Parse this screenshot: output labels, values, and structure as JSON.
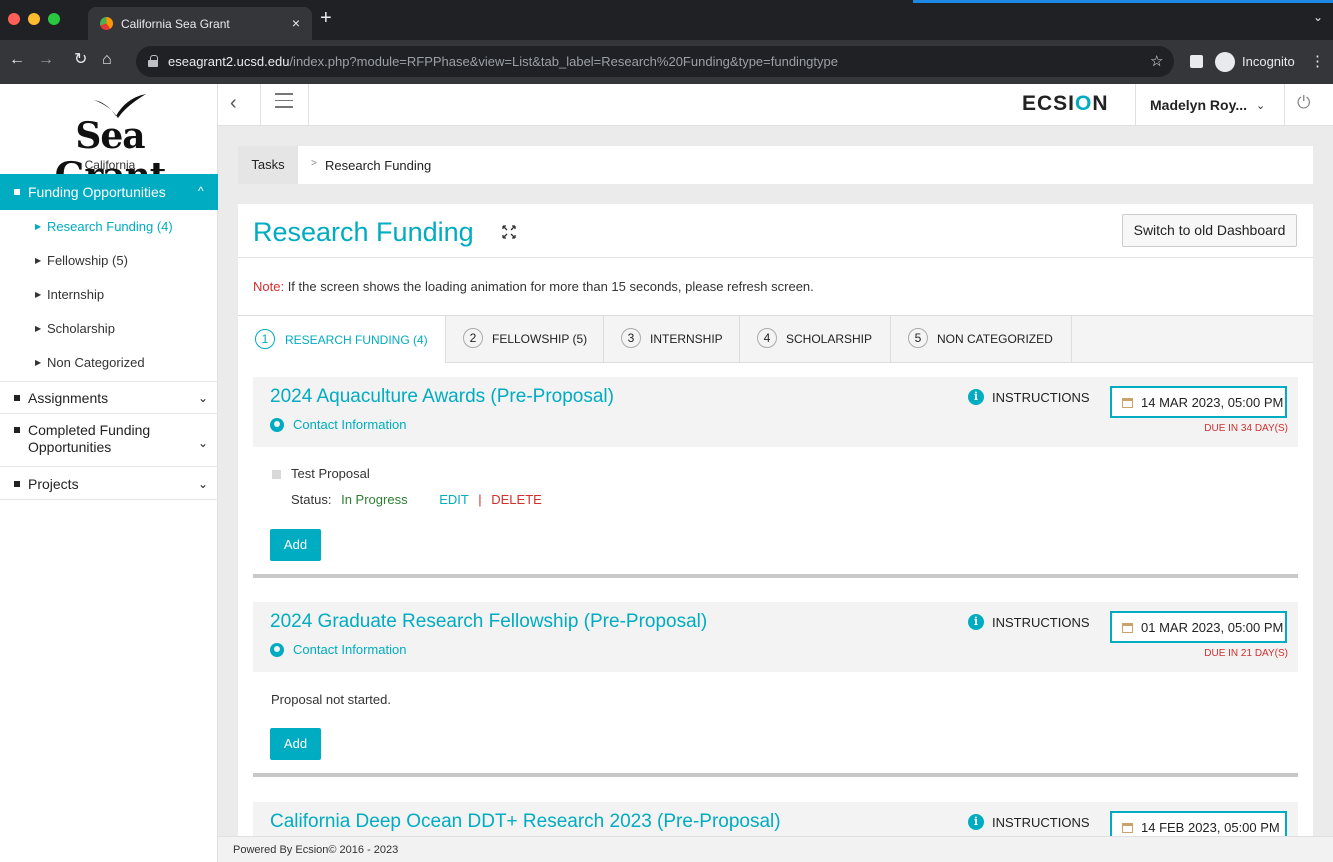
{
  "browser": {
    "tab_title": "California Sea Grant",
    "tab_close": "×",
    "new_tab": "+",
    "url_host": "eseagrant2.ucsd.edu",
    "url_path": "/index.php?module=RFPPhase&view=List&tab_label=Research%20Funding&type=fundingtype",
    "incognito_label": "Incognito"
  },
  "logo": {
    "word": "Sea Grant",
    "sub": "California"
  },
  "sidebar": {
    "active": {
      "label": "Funding Opportunities",
      "chevron": "^"
    },
    "subitems": [
      {
        "label": "Research Funding  (4)"
      },
      {
        "label": "Fellowship (5)"
      },
      {
        "label": "Internship"
      },
      {
        "label": "Scholarship"
      },
      {
        "label": "Non Categorized"
      }
    ],
    "items": [
      {
        "label": "Assignments"
      },
      {
        "label": "Completed Funding Opportunities"
      },
      {
        "label": "Projects"
      }
    ]
  },
  "header": {
    "brand_pre": "ECSI",
    "brand_o": "O",
    "brand_post": "N",
    "user": "Madelyn Roy..."
  },
  "breadcrumb": {
    "first": "Tasks",
    "sep": ">",
    "current": "Research Funding"
  },
  "page": {
    "title": "Research Funding",
    "old_dashboard_button": "Switch to old Dashboard",
    "note_label": "Note:",
    "note_text": " If the screen shows the loading animation for more than 15 seconds, please refresh screen."
  },
  "tabs": [
    {
      "num": "1",
      "label": "RESEARCH FUNDING (4)"
    },
    {
      "num": "2",
      "label": "FELLOWSHIP (5)"
    },
    {
      "num": "3",
      "label": "INTERNSHIP"
    },
    {
      "num": "4",
      "label": "SCHOLARSHIP"
    },
    {
      "num": "5",
      "label": "NON CATEGORIZED"
    }
  ],
  "cards": [
    {
      "title": "2024 Aquaculture Awards (Pre-Proposal)",
      "contact": "Contact Information",
      "instructions": "INSTRUCTIONS",
      "date": "14 MAR 2023, 05:00 PM",
      "due": "DUE IN 34 DAY(S)",
      "proposal_name": "Test Proposal",
      "status_label": "Status:",
      "status_value": "In Progress",
      "edit": "EDIT",
      "pipe": "|",
      "delete": "DELETE",
      "add": "Add"
    },
    {
      "title": "2024 Graduate Research Fellowship (Pre-Proposal)",
      "contact": "Contact Information",
      "instructions": "INSTRUCTIONS",
      "date": "01 MAR 2023, 05:00 PM",
      "due": "DUE IN 21 DAY(S)",
      "empty_text": "Proposal not started.",
      "add": "Add"
    },
    {
      "title": "California Deep Ocean DDT+ Research 2023 (Pre-Proposal)",
      "instructions": "INSTRUCTIONS",
      "date": "14 FEB 2023, 05:00 PM"
    }
  ],
  "footer": {
    "text": "Powered By Ecsion© 2016 - 2023"
  },
  "colors": {
    "accent": "#00acc1",
    "danger": "#d32f2f",
    "success": "#2e7d32"
  }
}
